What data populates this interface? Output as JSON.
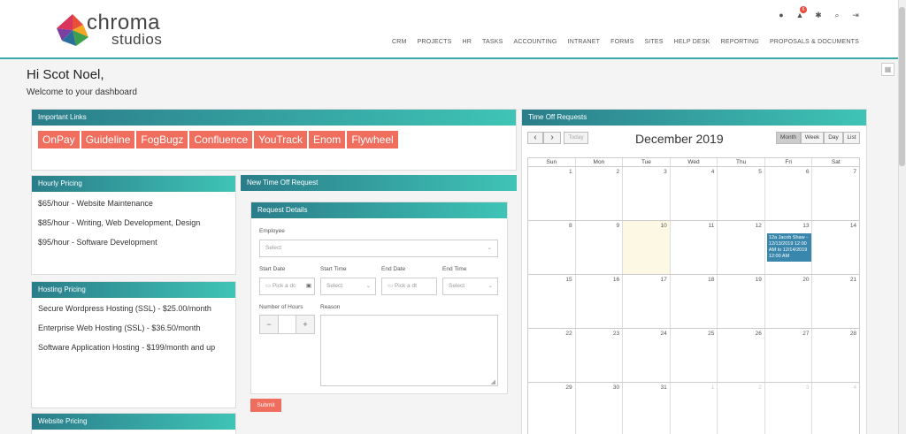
{
  "logo": {
    "line1": "chroma",
    "line2": "studios"
  },
  "nav": [
    "CRM",
    "PROJECTS",
    "HR",
    "TASKS",
    "ACCOUNTING",
    "INTRANET",
    "FORMS",
    "SITES",
    "HELP DESK",
    "REPORTING",
    "PROPOSALS & DOCUMENTS"
  ],
  "notifications": {
    "count": "6"
  },
  "greeting": "Hi Scot Noel,",
  "welcome": "Welcome to your dashboard",
  "important_links": {
    "title": "Important Links",
    "items": [
      "OnPay",
      "Guideline",
      "FogBugz",
      "Confluence",
      "YouTrack",
      "Enom",
      "Flywheel"
    ]
  },
  "hourly_pricing": {
    "title": "Hourly Pricing",
    "items": [
      "$65/hour - Website Maintenance",
      "$85/hour - Writing, Web Development, Design",
      "$95/hour - Software Development"
    ]
  },
  "hosting_pricing": {
    "title": "Hosting Pricing",
    "items": [
      "Secure Wordpress Hosting (SSL) - $25.00/month",
      "Enterprise Web Hosting (SSL) - $36.50/month",
      "Software Application Hosting - $199/month and up"
    ]
  },
  "website_pricing": {
    "title": "Website Pricing"
  },
  "new_time_off": {
    "title": "New Time Off Request",
    "details_title": "Request Details",
    "employee_label": "Employee",
    "employee_placeholder": "Select",
    "start_date_label": "Start Date",
    "start_date_placeholder": "Pick a dc",
    "start_time_label": "Start Time",
    "start_time_placeholder": "Select",
    "end_date_label": "End Date",
    "end_date_placeholder": "Pick a dt",
    "end_time_label": "End Time",
    "end_time_placeholder": "Select",
    "hours_label": "Number of Hours",
    "minus": "−",
    "plus": "+",
    "reason_label": "Reason",
    "submit": "Submit"
  },
  "time_off": {
    "title": "Time Off Requests",
    "prev": "‹",
    "next": "›",
    "today": "Today",
    "month_title": "December 2019",
    "views": [
      "Month",
      "Week",
      "Day",
      "List"
    ],
    "dow": [
      "Sun",
      "Mon",
      "Tue",
      "Wed",
      "Thu",
      "Fri",
      "Sat"
    ],
    "weeks": [
      [
        "1",
        "2",
        "3",
        "4",
        "5",
        "6",
        "7"
      ],
      [
        "8",
        "9",
        "10",
        "11",
        "12",
        "13",
        "14"
      ],
      [
        "15",
        "16",
        "17",
        "18",
        "19",
        "20",
        "21"
      ],
      [
        "22",
        "23",
        "24",
        "25",
        "26",
        "27",
        "28"
      ],
      [
        "29",
        "30",
        "31",
        "1",
        "2",
        "3",
        "4"
      ]
    ],
    "event": "12a Jacob Shaw - 12/13/2019 12:00 AM to 12/14/2019 12:00 AM"
  }
}
